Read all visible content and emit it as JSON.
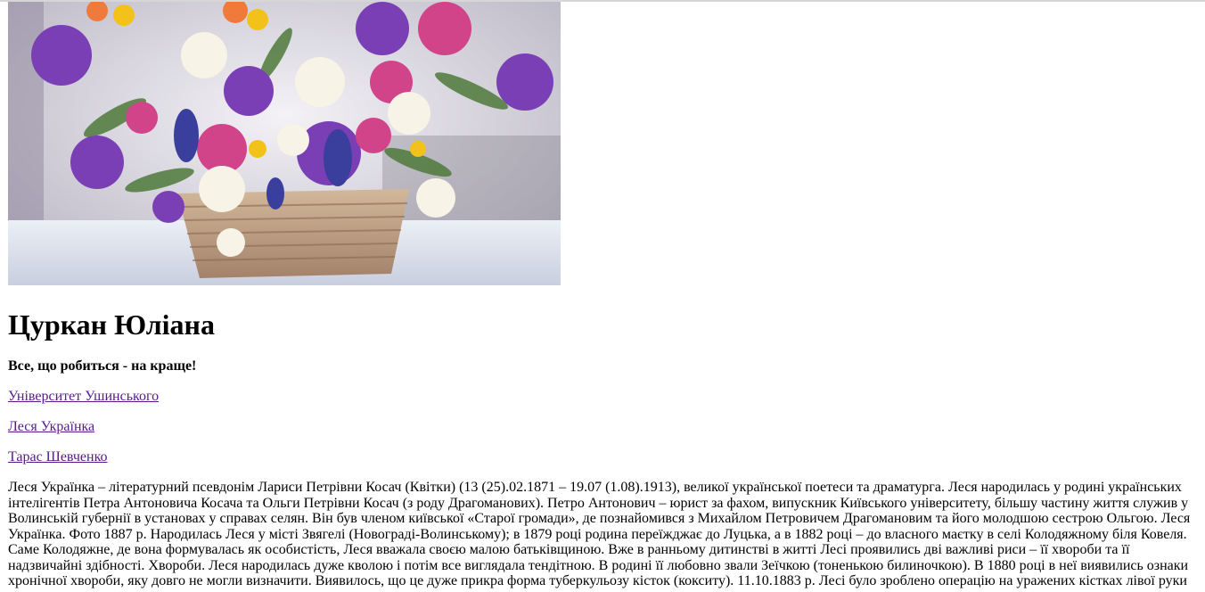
{
  "profile": {
    "name": "Цуркан Юліана",
    "motto": "Все, що робиться - на краще!"
  },
  "links": [
    {
      "label": "Університет Ушинського"
    },
    {
      "label": "Леся Українка"
    },
    {
      "label": "Тарас Шевченко"
    }
  ],
  "bio": {
    "text": "Леся Українка – літературний псевдонім Лариси Петрівни Косач (Квітки) (13 (25).02.1871 – 19.07 (1.08).1913), великої української поетеси та драматурга. Леся народилась у родині українських інтелігентів Петра Антоновича Косача та Ольги Петрівни Косач (з роду Драгоманових). Петро Антонович – юрист за фахом, випускник Київського університету, більшу частину життя служив у Волинській губернії в установах у справах селян. Він був членом київської «Старої громади», де познайомився з Михайлом Петровичем Драгомановим та його молодшою сестрою Ольгою. Леся Українка. Фото 1887 р. Народилась Леся у місті Звягелі (Новограді-Волинському); в 1879 році родина переїжджає до Луцька, а в 1882 році – до власного маєтку в селі Колодяжному біля Ковеля. Саме Колодяжне, де вона формувалась як особистість, Леся вважала своєю малою батьківщиною. Вже в ранньому дитинстві в житті Лесі проявились дві важливі риси – її хвороби та її надзвичайні здібності. Хвороби. Леся народилась дуже кволою і потім все виглядала тендітною. В родині її любовно звали Зеїчкою (тоненькою билиночкою). В 1880 році в неї виявились ознаки хронічної хвороби, яку довго не могли визначити. Виявилось, що це дуже прикра форма туберкульозу кісток (кокситу). 11.10.1883 р. Лесі було зроблено операцію на уражених кістках лівої руки"
  },
  "colors": {
    "link": "#551a8b",
    "text": "#000000",
    "background": "#ffffff"
  },
  "icons": {
    "hero": "flower-basket-photo"
  }
}
